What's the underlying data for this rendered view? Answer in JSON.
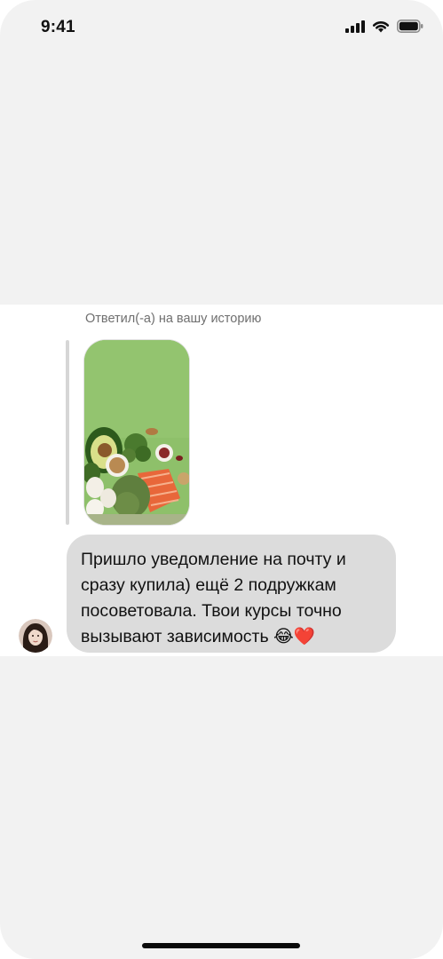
{
  "status_bar": {
    "time": "9:41",
    "icons": [
      "cellular-signal-icon",
      "wifi-icon",
      "battery-icon"
    ]
  },
  "story_reply": {
    "caption": "Ответил(-а) на вашу историю",
    "thumbnail": "food-story-thumbnail"
  },
  "message": {
    "text": "Пришло уведомление на почту и сразу купила) ещё 2 подружкам посоветовала. Твои курсы точно вызывают зависимость 😂❤️"
  },
  "sender": {
    "avatar": "avatar"
  },
  "colors": {
    "background": "#f2f2f2",
    "panel": "#ffffff",
    "bubble": "#dcdcdc",
    "caption": "#6f6f6f"
  }
}
